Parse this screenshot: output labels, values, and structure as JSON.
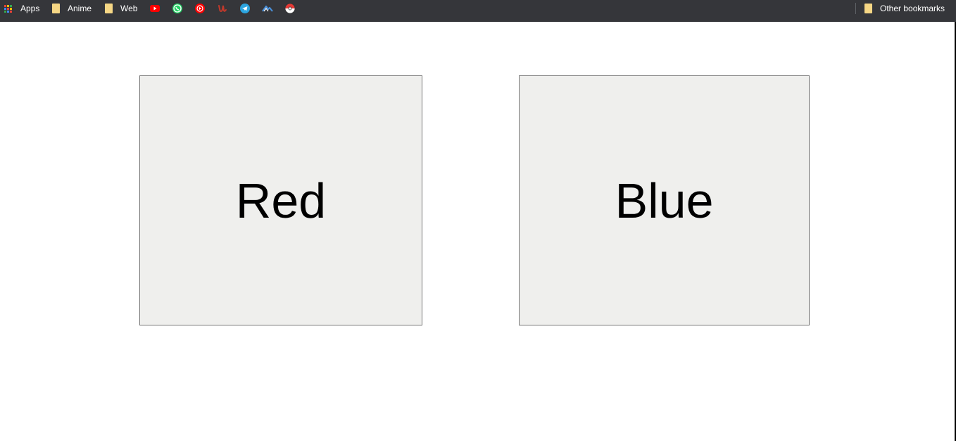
{
  "bookmarks_bar": {
    "apps_label": "Apps",
    "folders": [
      {
        "label": "Anime",
        "icon": "folder-icon"
      },
      {
        "label": "Web",
        "icon": "folder-icon"
      }
    ],
    "shortcuts": [
      {
        "icon": "youtube-icon",
        "color": "#ff0000"
      },
      {
        "icon": "whatsapp-icon",
        "color": "#25d366"
      },
      {
        "icon": "youtube-music-icon",
        "color": "#ff0000"
      },
      {
        "icon": "u-logo-icon",
        "color": "#c0392b"
      },
      {
        "icon": "telegram-icon",
        "color": "#2ca5e0"
      },
      {
        "icon": "mountain-icon",
        "color": "#4a90d9"
      },
      {
        "icon": "pokeball-icon",
        "color": "#e53935"
      }
    ],
    "other_bookmarks_label": "Other bookmarks"
  },
  "main": {
    "buttons": [
      {
        "label": "Red"
      },
      {
        "label": "Blue"
      }
    ]
  }
}
